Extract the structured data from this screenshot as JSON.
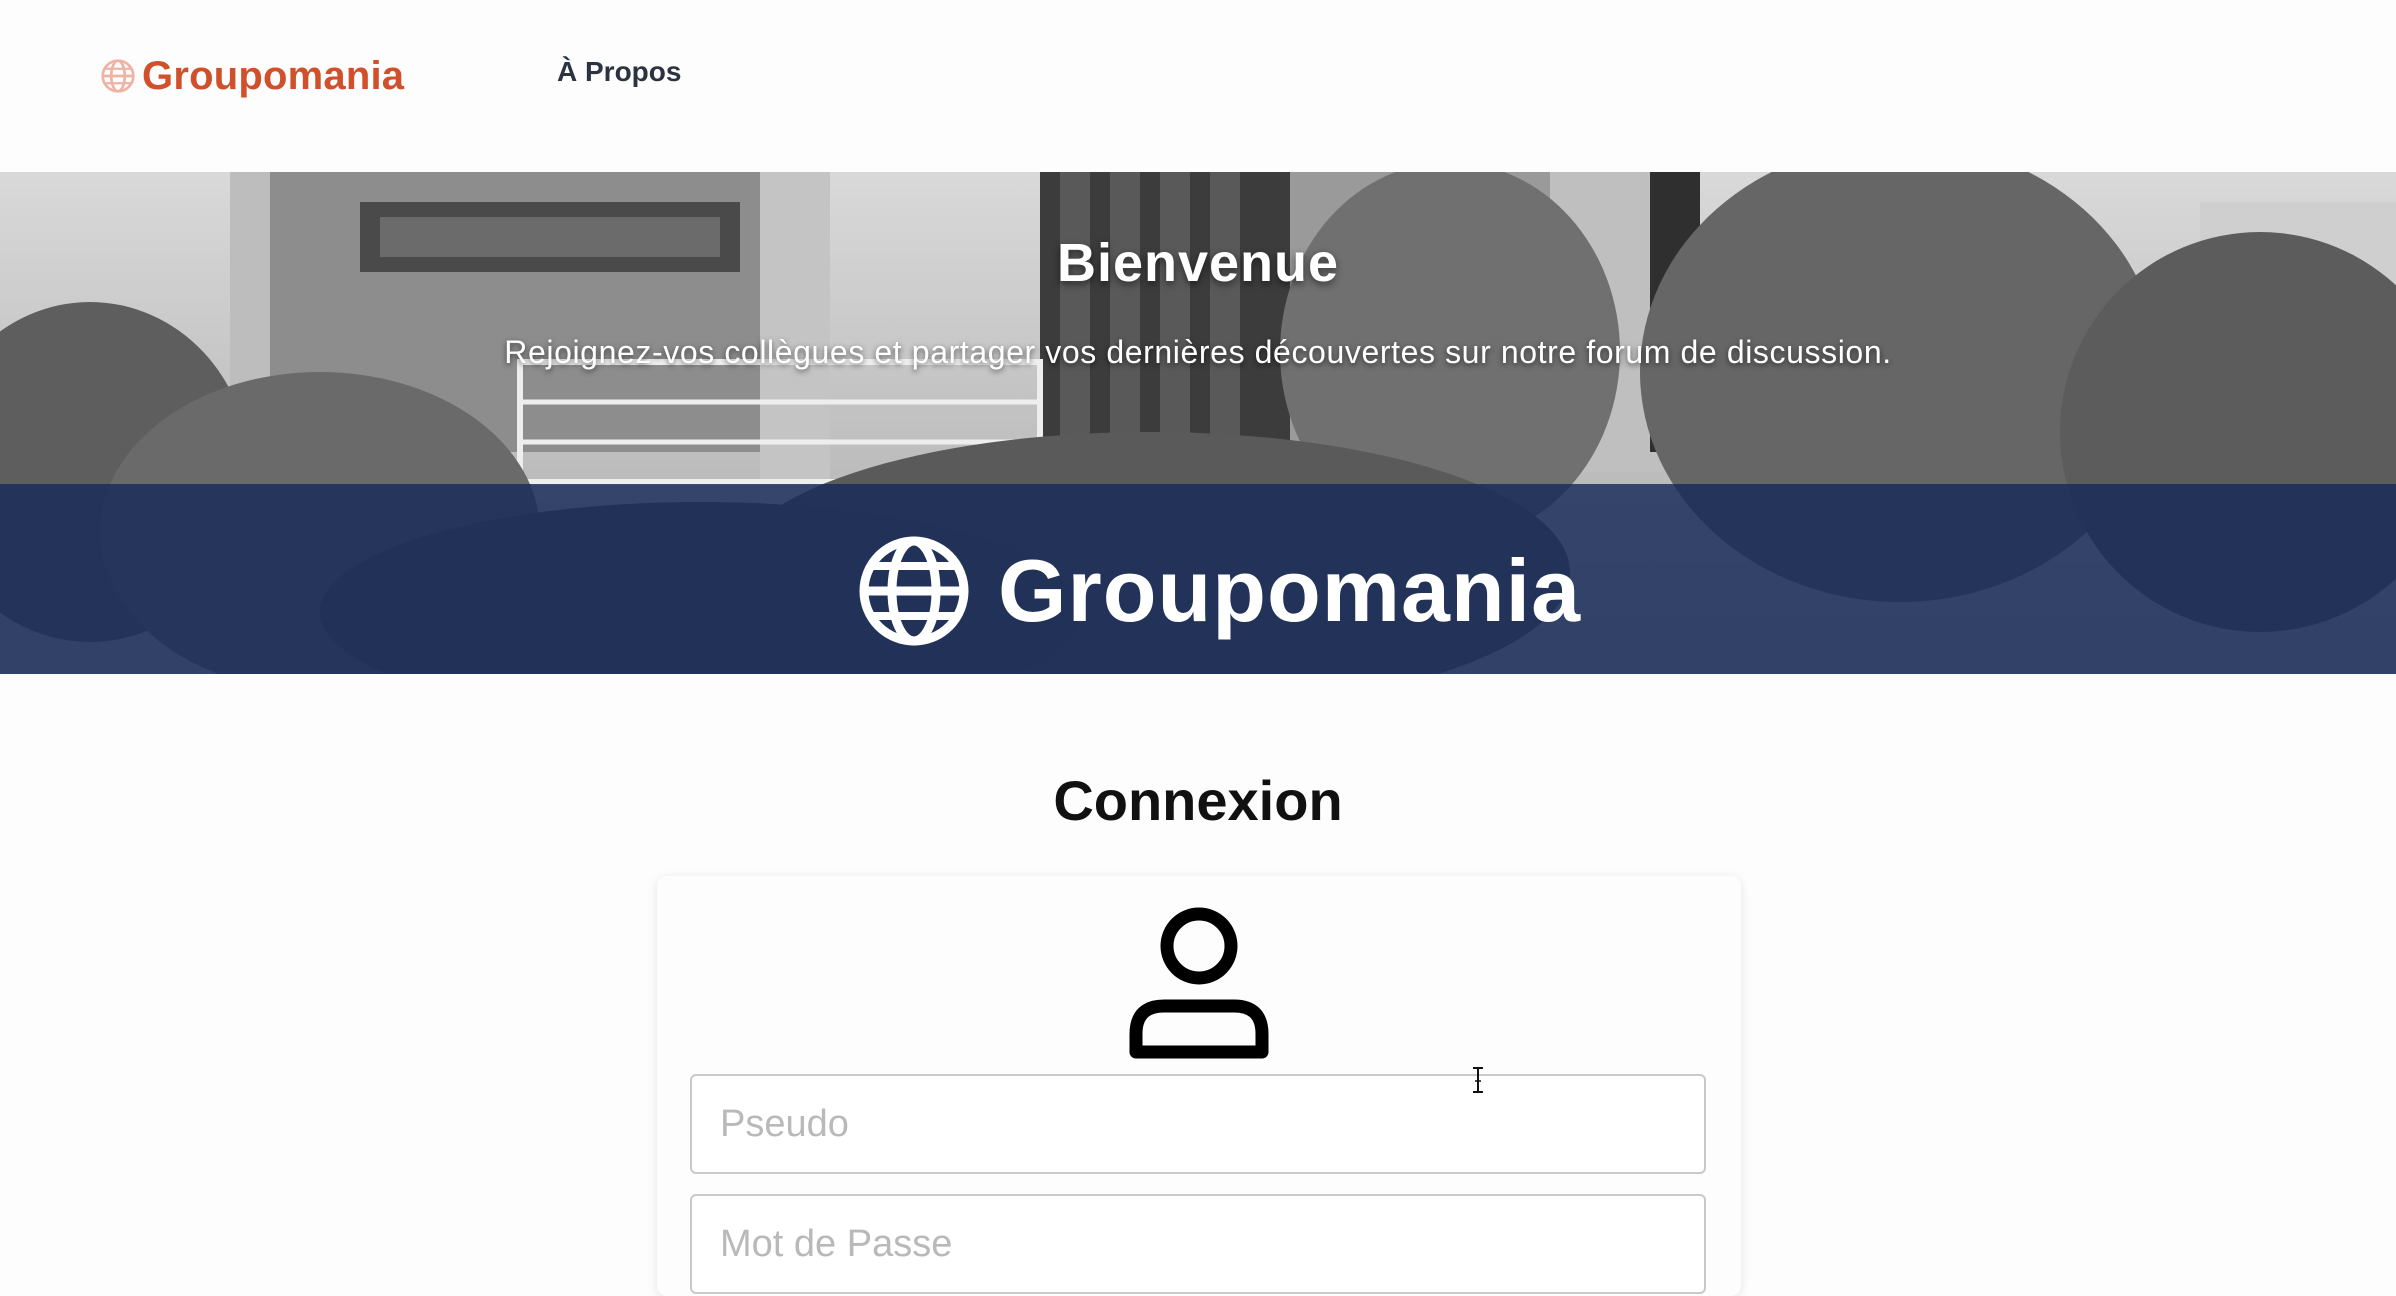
{
  "header": {
    "brand_name": "Groupomania",
    "nav_about": "À Propos"
  },
  "hero": {
    "title": "Bienvenue",
    "subtitle": "Rejoignez-vos collègues et partager vos dernières découvertes sur notre forum de discussion.",
    "band_logo_text": "Groupomania"
  },
  "login": {
    "title": "Connexion",
    "pseudo_placeholder": "Pseudo",
    "password_placeholder": "Mot de Passe"
  },
  "icons": {
    "brand": "globe-icon",
    "band": "globe-icon",
    "user": "user-icon",
    "cursor": "text-cursor-icon"
  },
  "colors": {
    "brand": "#d1502c",
    "band_overlay": "#162a58",
    "nav_text": "#2b3340"
  }
}
